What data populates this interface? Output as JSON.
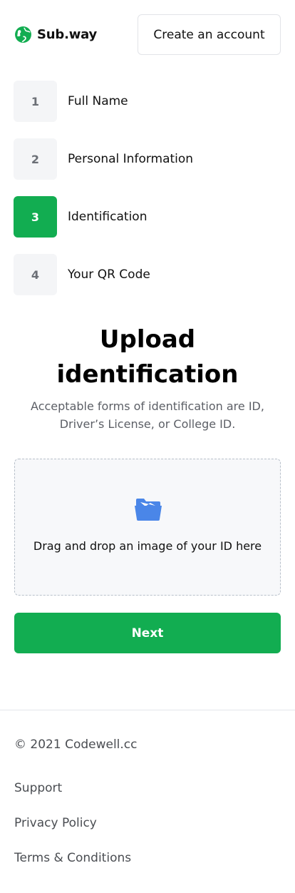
{
  "brand": {
    "name": "Sub.way",
    "icon": "globe-icon",
    "color": "#12ad51"
  },
  "header": {
    "create_account_label": "Create an account"
  },
  "steps": [
    {
      "number": "1",
      "label": "Full Name",
      "active": false
    },
    {
      "number": "2",
      "label": "Personal Information",
      "active": false
    },
    {
      "number": "3",
      "label": "Identification",
      "active": true
    },
    {
      "number": "4",
      "label": "Your QR Code",
      "active": false
    }
  ],
  "main": {
    "title_line1": "Upload",
    "title_line2": "identification",
    "subtitle": "Acceptable forms of identification are ID, Driver’s License, or College ID.",
    "dropzone_text": "Drag and drop an image of your ID here",
    "dropzone_icon": "folder-open-icon",
    "next_label": "Next"
  },
  "footer": {
    "copyright": "© 2021 Codewell.cc",
    "links": [
      "Support",
      "Privacy Policy",
      "Terms & Conditions"
    ]
  },
  "colors": {
    "accent": "#12ad51",
    "step_inactive_bg": "#f4f5f7",
    "folder_blue": "#4a86e8"
  }
}
